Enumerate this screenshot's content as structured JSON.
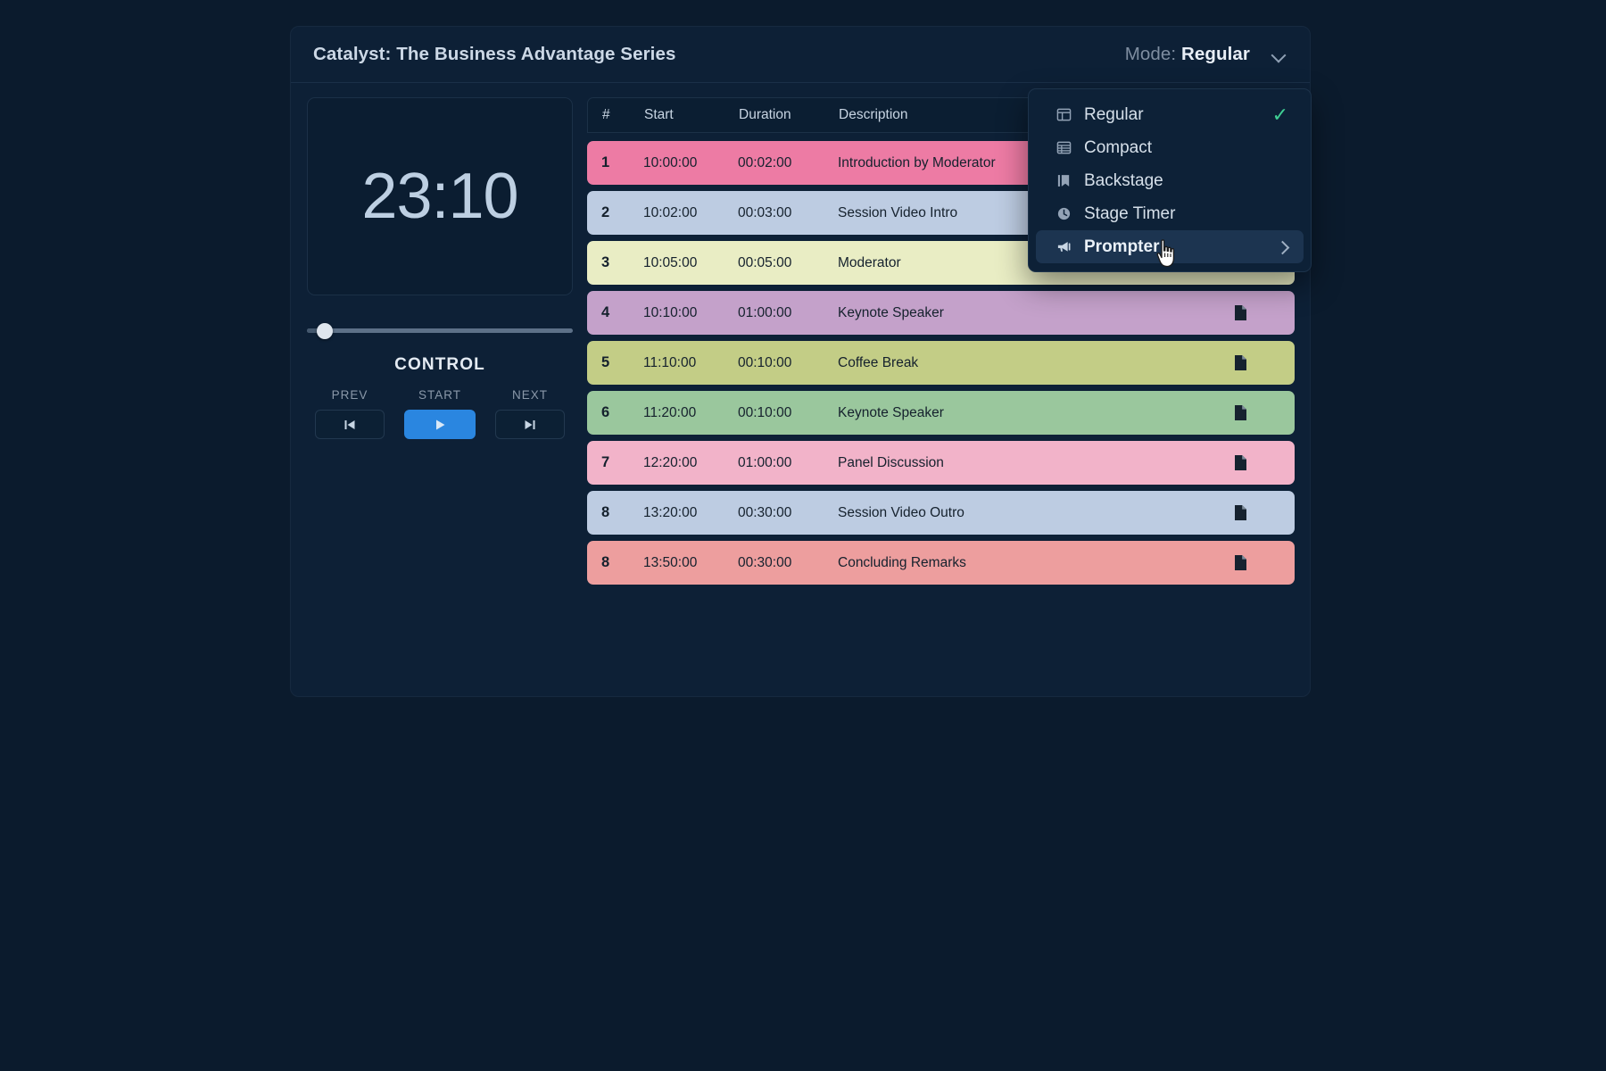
{
  "header": {
    "title": "Catalyst: The Business Advantage Series",
    "mode_label": "Mode:",
    "mode_value": "Regular",
    "chevron_icon": "chevron-down-icon"
  },
  "control_panel": {
    "timer": "23:10",
    "progress_percent": 5,
    "control_title": "CONTROL",
    "buttons": [
      {
        "caption": "PREV",
        "icon": "skip-back-icon",
        "variant": "secondary"
      },
      {
        "caption": "START",
        "icon": "play-icon",
        "variant": "primary"
      },
      {
        "caption": "NEXT",
        "icon": "skip-forward-icon",
        "variant": "secondary"
      }
    ]
  },
  "schedule": {
    "columns": [
      "#",
      "Start",
      "Duration",
      "Description"
    ],
    "doc_icon": "document-icon",
    "rows": [
      {
        "num": "1",
        "start": "10:00:00",
        "duration": "00:02:00",
        "description": "Introduction by Moderator",
        "color": "#ed7ba4",
        "has_doc": true
      },
      {
        "num": "2",
        "start": "10:02:00",
        "duration": "00:03:00",
        "description": "Session Video Intro",
        "color": "#bdcce2",
        "has_doc": true
      },
      {
        "num": "3",
        "start": "10:05:00",
        "duration": "00:05:00",
        "description": "Moderator",
        "color": "#e9edc4",
        "has_doc": true
      },
      {
        "num": "4",
        "start": "10:10:00",
        "duration": "01:00:00",
        "description": "Keynote Speaker",
        "color": "#c4a1ca",
        "has_doc": true
      },
      {
        "num": "5",
        "start": "11:10:00",
        "duration": "00:10:00",
        "description": "Coffee Break",
        "color": "#c3cd86",
        "has_doc": true
      },
      {
        "num": "6",
        "start": "11:20:00",
        "duration": "00:10:00",
        "description": "Keynote Speaker",
        "color": "#9ac79d",
        "has_doc": true
      },
      {
        "num": "7",
        "start": "12:20:00",
        "duration": "01:00:00",
        "description": "Panel Discussion",
        "color": "#f2b3c9",
        "has_doc": true
      },
      {
        "num": "8",
        "start": "13:20:00",
        "duration": "00:30:00",
        "description": "Session Video Outro",
        "color": "#bdcce2",
        "has_doc": true
      },
      {
        "num": "8",
        "start": "13:50:00",
        "duration": "00:30:00",
        "description": "Concluding Remarks",
        "color": "#ed9e9e",
        "has_doc": true
      }
    ]
  },
  "mode_menu": {
    "items": [
      {
        "label": "Regular",
        "icon": "layout-panel-icon",
        "checked": true,
        "highlighted": false,
        "has_submenu": false
      },
      {
        "label": "Compact",
        "icon": "list-table-icon",
        "checked": false,
        "highlighted": false,
        "has_submenu": false
      },
      {
        "label": "Backstage",
        "icon": "bookmark-icon",
        "checked": false,
        "highlighted": false,
        "has_submenu": false
      },
      {
        "label": "Stage Timer",
        "icon": "clock-icon",
        "checked": false,
        "highlighted": false,
        "has_submenu": false
      },
      {
        "label": "Prompter",
        "icon": "megaphone-icon",
        "checked": false,
        "highlighted": true,
        "has_submenu": true
      }
    ],
    "check_glyph": "✓",
    "check_color": "#3fcf94"
  },
  "cursor": {
    "icon": "pointing-hand-cursor"
  }
}
